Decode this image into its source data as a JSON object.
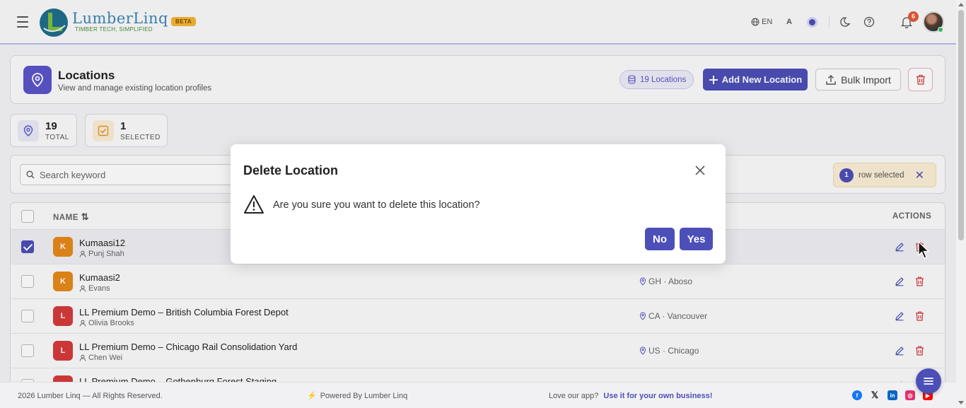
{
  "header": {
    "brand_name": "LumberLinq",
    "brand_tagline": "TIMBER TECH, SIMPLIFIED",
    "beta_label": "BETA",
    "language": "EN",
    "font_size_label": "A",
    "notification_count": "6"
  },
  "page": {
    "title": "Locations",
    "subtitle": "View and manage existing location profiles",
    "count_pill": "19 Locations",
    "add_button": "Add New Location",
    "import_button": "Bulk Import"
  },
  "stats": {
    "total_value": "19",
    "total_label": "TOTAL",
    "selected_value": "1",
    "selected_label": "SELECTED"
  },
  "search": {
    "placeholder": "Search keyword"
  },
  "selection": {
    "count": "1",
    "label": "row selected"
  },
  "table": {
    "col_name": "NAME",
    "col_actions": "ACTIONS",
    "rows": [
      {
        "initial": "K",
        "name": "Kumaasi12",
        "owner": "Punj Shah",
        "place": "",
        "color": "#e68a1a",
        "selected": true
      },
      {
        "initial": "K",
        "name": "Kumaasi2",
        "owner": "Evans",
        "place": "GH · Aboso",
        "color": "#e68a1a",
        "selected": false
      },
      {
        "initial": "L",
        "name": "LL Premium Demo – British Columbia Forest Depot",
        "owner": "Olivia Brooks",
        "place": "CA · Vancouver",
        "color": "#d63a3a",
        "selected": false
      },
      {
        "initial": "L",
        "name": "LL Premium Demo – Chicago Rail Consolidation Yard",
        "owner": "Chen Wei",
        "place": "US · Chicago",
        "color": "#d63a3a",
        "selected": false
      },
      {
        "initial": "L",
        "name": "LL Premium Demo – Gothenburg Forest Staging",
        "owner": "",
        "place": "",
        "color": "#d63a3a",
        "selected": false
      }
    ]
  },
  "modal": {
    "title": "Delete Location",
    "message": "Are you sure you want to delete this location?",
    "no_label": "No",
    "yes_label": "Yes"
  },
  "footer": {
    "copyright": "2026 Lumber Linq — All Rights Reserved.",
    "powered": "Powered By Lumber Linq",
    "love_text": "Love our app?",
    "love_link": "Use it for your own business!"
  },
  "colors": {
    "accent": "#4c4fb7",
    "danger": "#d63a3a"
  }
}
